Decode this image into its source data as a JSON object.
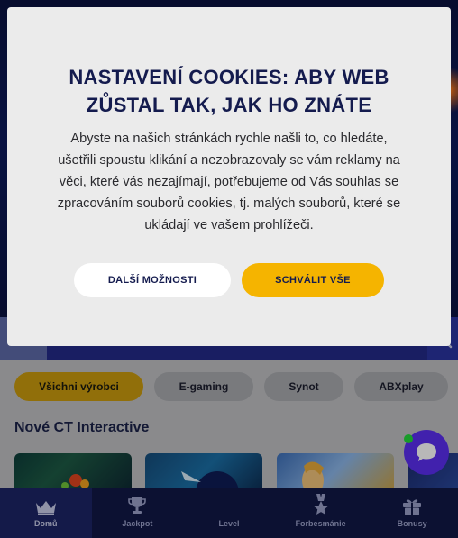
{
  "cookie_modal": {
    "title_line1": "NASTAVENÍ COOKIES: ABY WEB",
    "title_line2": "ZŮSTAL TAK, JAK HO ZNÁTE",
    "body_lines": [
      "Abyste na našich stránkách rychle našli to, co hledáte,",
      "ušetřili spoustu klikání a nezobrazovaly se vám reklamy na",
      "věci, které vás nezajímají, potřebujeme od Vás souhlas se",
      "zpracováním souborů cookies, tj. malých souborů, které se",
      "ukládají ve vašem prohlížeči."
    ],
    "more_options_label": "DALŠÍ MOŽNOSTI",
    "accept_all_label": "SCHVÁLIT VŠE"
  },
  "filters": {
    "chips": [
      "Všichni výrobci",
      "E-gaming",
      "Synot",
      "ABXplay"
    ],
    "active_index": 0
  },
  "section": {
    "title": "Nové CT Interactive"
  },
  "bottom_nav": {
    "items": [
      {
        "label": "Domů",
        "icon": "crown-icon"
      },
      {
        "label": "Jackpot",
        "icon": "trophy-icon"
      },
      {
        "label": "Level",
        "icon": "level-icon"
      },
      {
        "label": "Forbesmánie",
        "icon": "star-medal-icon"
      },
      {
        "label": "Bonusy",
        "icon": "gift-icon"
      }
    ],
    "active_index": 0
  },
  "colors": {
    "accent_yellow": "#f5b400",
    "navy": "#141b4e",
    "chat_purple": "#5b2ff0",
    "online_green": "#22d83a"
  }
}
